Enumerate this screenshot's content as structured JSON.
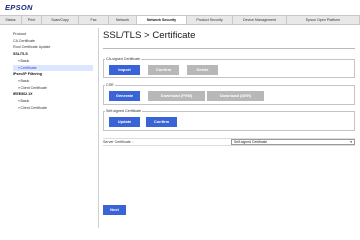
{
  "header": {
    "logo": "EPSON"
  },
  "tabs": [
    {
      "label": "Status"
    },
    {
      "label": "Print"
    },
    {
      "label": "Scan/Copy"
    },
    {
      "label": "Fax"
    },
    {
      "label": "Network"
    },
    {
      "label": "Network Security",
      "active": true
    },
    {
      "label": "Product Security"
    },
    {
      "label": "Device Management"
    },
    {
      "label": "Epson Open Platform"
    }
  ],
  "sidebar": {
    "items": [
      {
        "label": "Protocol"
      },
      {
        "label": "CA Certificate"
      },
      {
        "label": "Root Certificate Update"
      },
      {
        "label": "SSL/TLS"
      },
      {
        "label": "Basic"
      },
      {
        "label": "Certificate"
      },
      {
        "label": "IPsec/IP Filtering"
      },
      {
        "label": "Basic"
      },
      {
        "label": "Client Certificate"
      },
      {
        "label": "IEEE802.1X"
      },
      {
        "label": "Basic"
      },
      {
        "label": "Client Certificate"
      }
    ]
  },
  "page": {
    "title": "SSL/TLS > Certificate"
  },
  "ca_signed": {
    "label": "CA-signed Certificate",
    "import_label": "Import",
    "confirm_label": "Confirm",
    "delete_label": "Delete"
  },
  "csr": {
    "label": "CSR",
    "generate_label": "Generate",
    "download_pem_label": "Download (PEM)",
    "download_der_label": "Download (DER)"
  },
  "self_signed": {
    "label": "Self-signed Certificate",
    "update_label": "Update",
    "confirm_label": "Confirm"
  },
  "server_certificate": {
    "label": "Server Certificate :",
    "value": "Self-signed Certificate"
  },
  "footer": {
    "next_label": "Next"
  },
  "colors": {
    "primary": "#3a63d8",
    "disabled": "#b8b8b8",
    "logo": "#1a2a7a",
    "active_bg": "#dde6ff"
  }
}
